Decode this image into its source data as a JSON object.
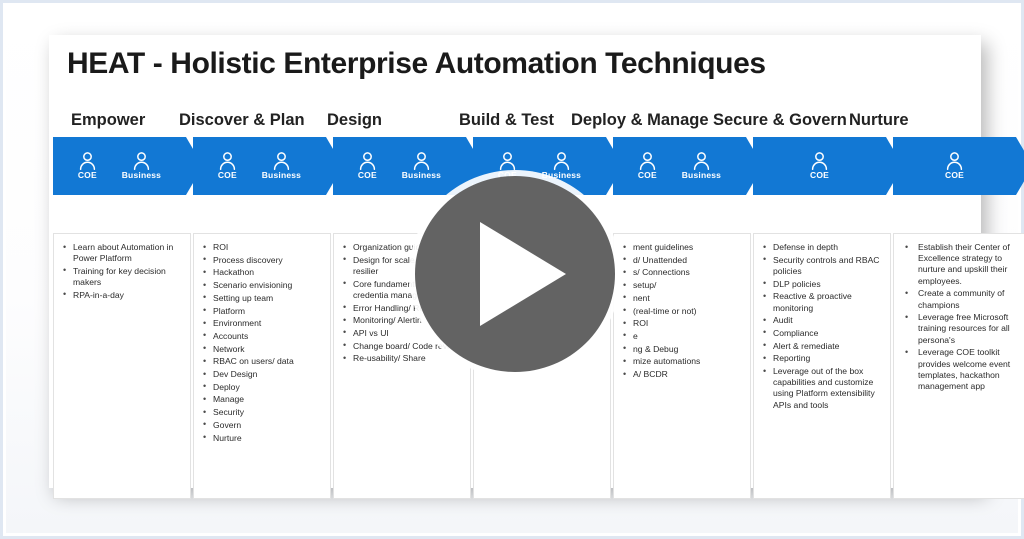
{
  "slide": {
    "title": "HEAT - Holistic Enterprise Automation Techniques",
    "accent_color": "#1278D4",
    "background_color": "#FFFFFF"
  },
  "overlay": {
    "play_button": {
      "name": "play-button",
      "icon": "play-triangle-icon",
      "circle_color": "#636363",
      "triangle_color": "#FFFFFF",
      "ring_color": "#FFFFFF"
    }
  },
  "stages": [
    {
      "header": "Empower",
      "personas": [
        "COE",
        "Business"
      ],
      "bullets": [
        "Learn about Automation in Power Platform",
        "Training for key decision makers",
        "RPA-in-a-day"
      ]
    },
    {
      "header": "Discover & Plan",
      "personas": [
        "COE",
        "Business"
      ],
      "bullets": [
        "ROI",
        "Process discovery",
        "Hackathon",
        "Scenario envisioning",
        "Setting up team",
        "Platform",
        "Environment",
        "Accounts",
        "Network",
        "RBAC on users/ data",
        "Dev Design",
        "Deploy",
        "Manage",
        "Security",
        "Govern",
        "Nurture"
      ]
    },
    {
      "header": "Design",
      "personas": [
        "COE",
        "Business"
      ],
      "bullets": [
        "Organization guidelin",
        "Design for scale/ throughput/ resilier",
        "Core fundamentals logging/ credentia management/ test",
        "Error Handling/ Re",
        "Monitoring/ Alertin",
        "API vs UI",
        "Change board/ Code review",
        "Re-usability/ Share"
      ]
    },
    {
      "header": "Build & Test",
      "personas": [
        "COE",
        "Business"
      ],
      "bullets": []
    },
    {
      "header": "Deploy & Manage",
      "personas": [
        "COE",
        "Business"
      ],
      "bullets": [
        "ment guidelines",
        "d/ Unattended",
        "s/ Connections",
        "setup/",
        "nent",
        "(real-time or not)",
        "ROI",
        "e",
        "ng & Debug",
        "mize automations",
        "A/ BCDR"
      ]
    },
    {
      "header": "Secure & Govern",
      "personas": [
        "COE"
      ],
      "bullets": [
        "Defense in depth",
        "Security controls and RBAC policies",
        "DLP policies",
        "Reactive & proactive monitoring",
        "Audit",
        "Compliance",
        "Alert & remediate",
        "Reporting",
        "Leverage out of the box capabilities and customize using Platform extensibility APIs and tools"
      ]
    },
    {
      "header": "Nurture",
      "personas": [
        "COE"
      ],
      "bullets": [
        "Establish their Center of Excellence strategy to nurture and upskill their employees.",
        "Create a community of champions",
        "Leverage free Microsoft training resources for all persona's",
        "Leverage COE toolkit provides welcome event templates, hackathon management app"
      ]
    }
  ]
}
